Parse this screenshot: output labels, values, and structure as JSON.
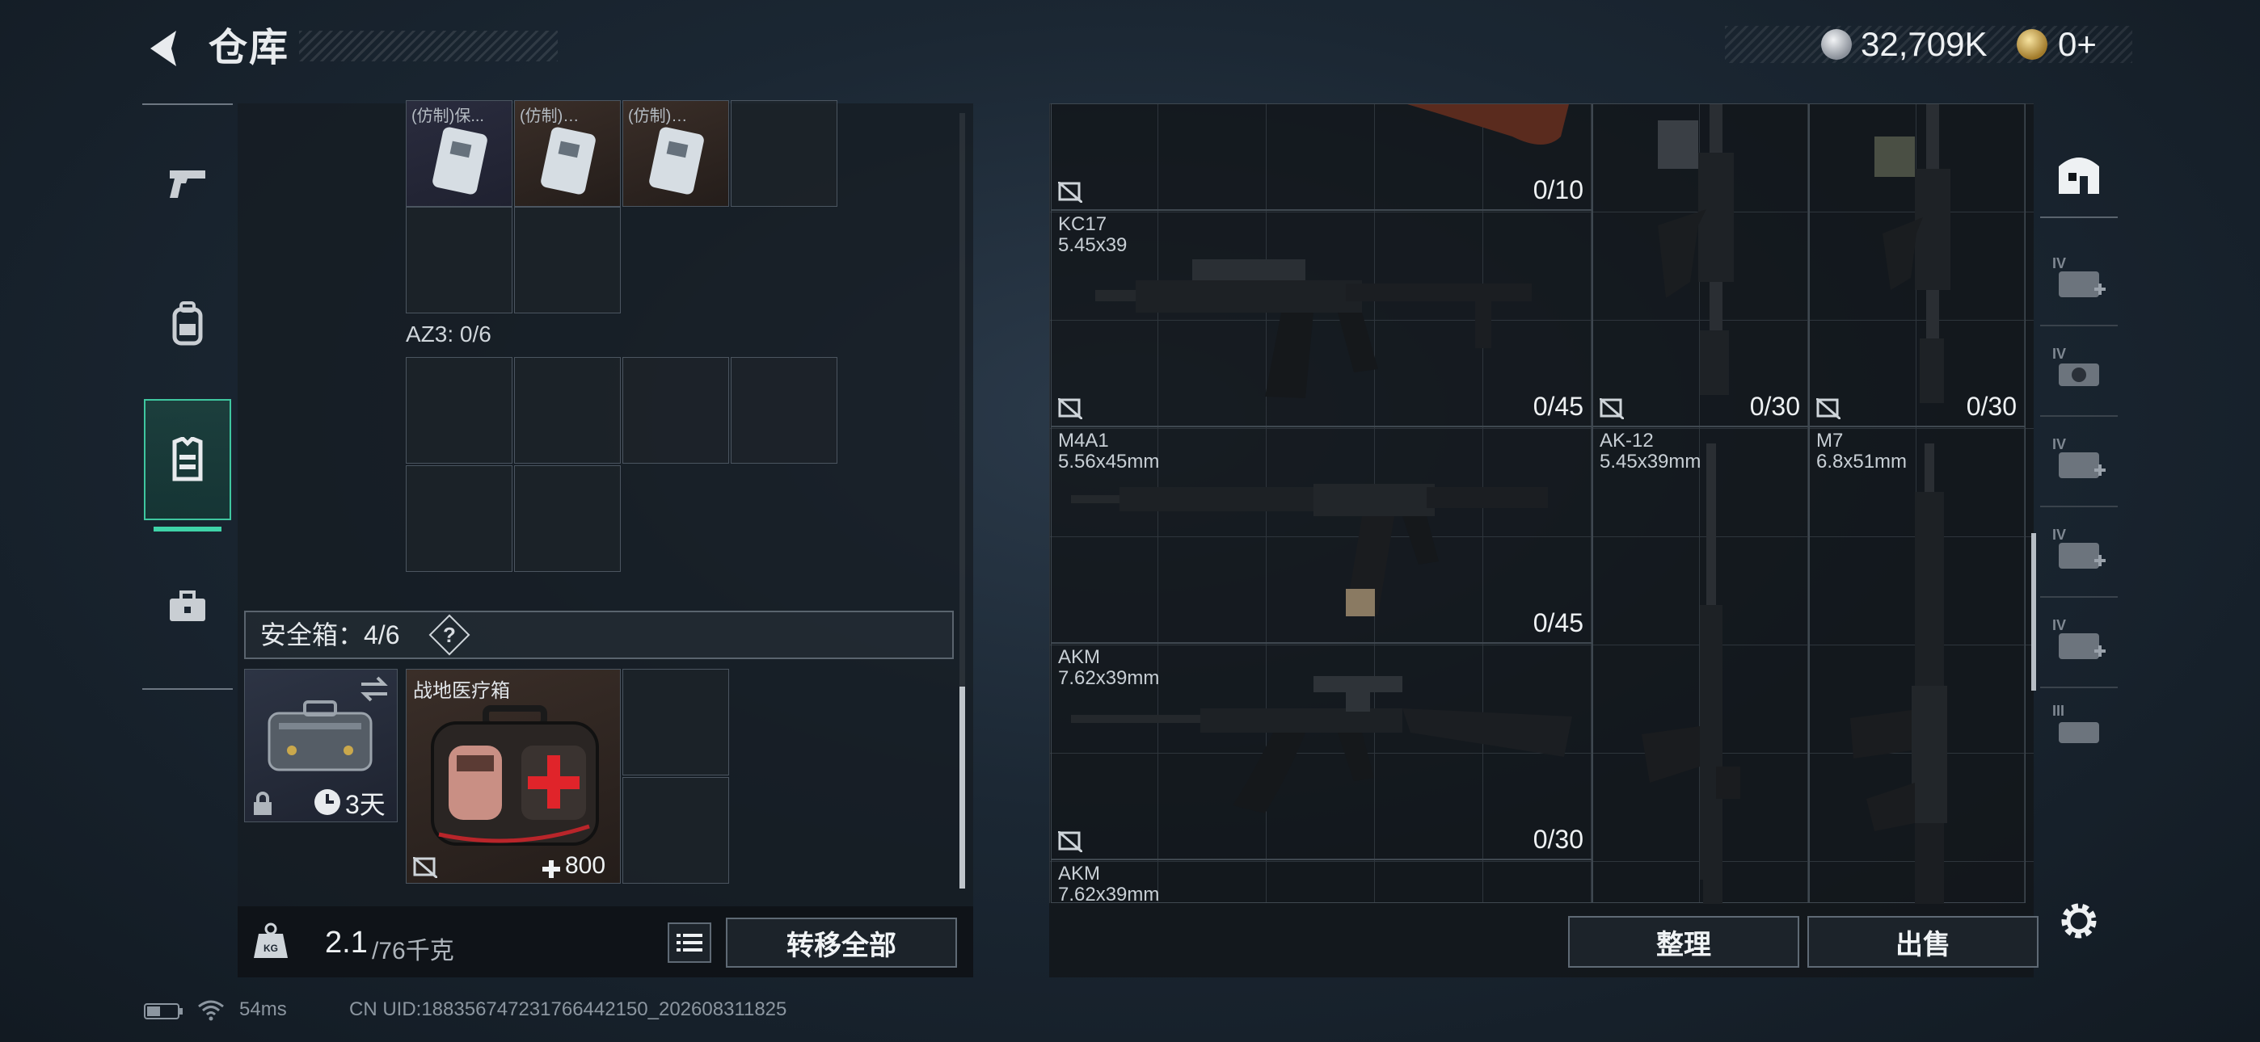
{
  "header": {
    "title": "仓库"
  },
  "currency": {
    "silver": "32,709K",
    "gold": "0+"
  },
  "left_nav": {
    "items": [
      "pistol",
      "backpack",
      "vest",
      "medkit"
    ],
    "active": "vest"
  },
  "inventory": {
    "top_items": [
      "(仿制)保...",
      "(仿制)…",
      "(仿制)…"
    ],
    "az3_label": "AZ3: 0/6",
    "safe_label": "安全箱：4/6",
    "safe_help": "?",
    "safe_box": {
      "timer": "3天"
    },
    "med_item": {
      "name": "战地医疗箱",
      "value": "800"
    }
  },
  "weight": {
    "value": "2.1",
    "capacity": "/76千克"
  },
  "buttons": {
    "transfer_all": "转移全部",
    "organize": "整理",
    "sell": "出售"
  },
  "weapons": [
    {
      "name": "",
      "caliber": "",
      "count": "0/10"
    },
    {
      "name": "KC17",
      "caliber": "5.45x39",
      "count": "0/45"
    },
    {
      "name": "",
      "caliber": "",
      "count": "0/30"
    },
    {
      "name": "",
      "caliber": "",
      "count": "0/30"
    },
    {
      "name": "M4A1",
      "caliber": "5.56x45mm",
      "count": "0/45"
    },
    {
      "name": "AK-12",
      "caliber": "5.45x39mm",
      "count": ""
    },
    {
      "name": "M7",
      "caliber": "6.8x51mm",
      "count": ""
    },
    {
      "name": "AKM",
      "caliber": "7.62x39mm",
      "count": "0/30"
    },
    {
      "name": "AKM",
      "caliber": "7.62x39mm",
      "count": ""
    }
  ],
  "right_nav": {
    "tiers": [
      "IV",
      "IV",
      "IV",
      "IV",
      "IV",
      "III"
    ]
  },
  "footer": {
    "ping": "54ms",
    "uid": "CN UID:1883567472317664421­50_202608311825"
  }
}
